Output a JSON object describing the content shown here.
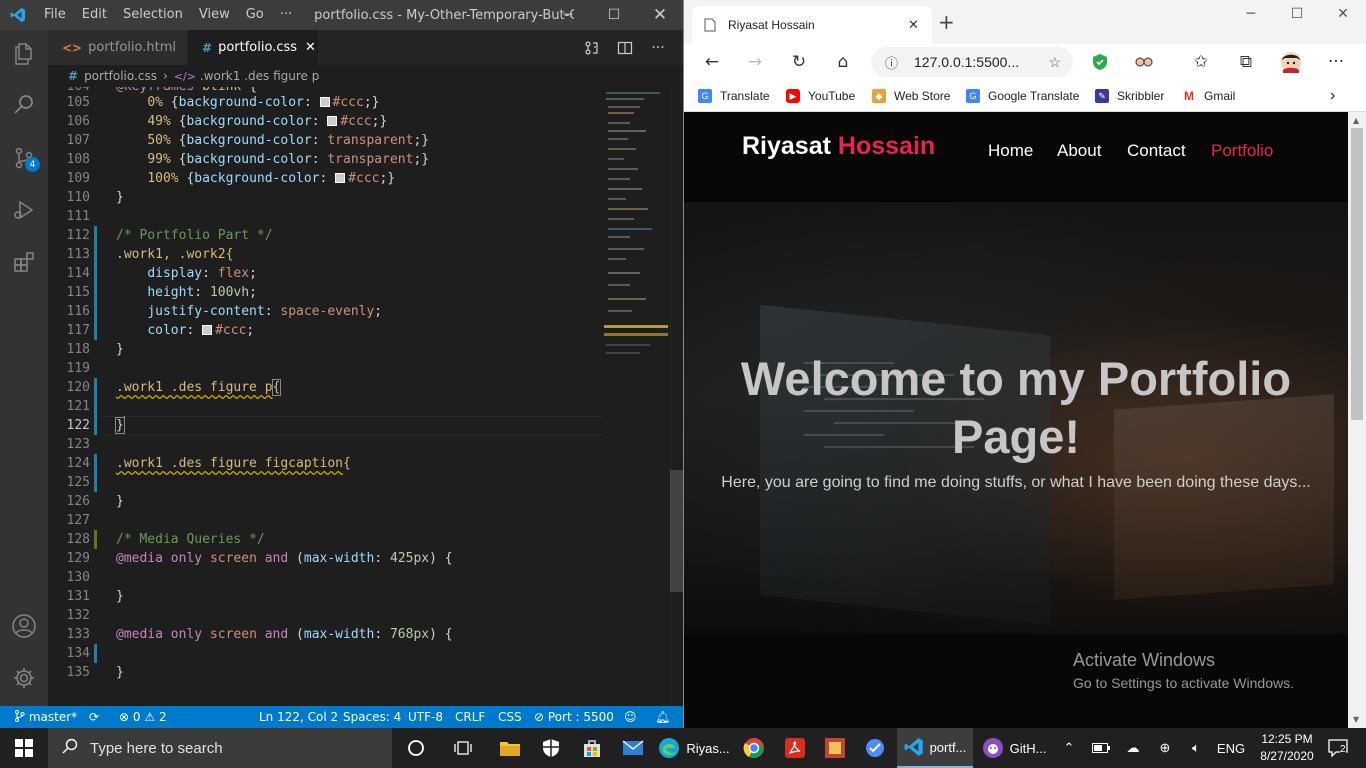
{
  "vscode": {
    "menu": [
      "File",
      "Edit",
      "Selection",
      "View",
      "Go",
      "···"
    ],
    "title": "portfolio.css - My-Other-Temporary-But-Cool-...",
    "tabs": [
      {
        "label": "portfolio.html",
        "icon": "<>",
        "active": false
      },
      {
        "label": "portfolio.css",
        "icon": "#",
        "active": true
      }
    ],
    "breadcrumb": {
      "file": "portfolio.css",
      "symbol": ".work1 .des figure p"
    },
    "scm_badge": "4",
    "status": {
      "branch": "master*",
      "problems_errors": "0",
      "problems_warnings": "2",
      "position": "Ln 122, Col 2",
      "spaces": "Spaces: 4",
      "encoding": "UTF-8",
      "eol": "CRLF",
      "language": "CSS",
      "port": "Port : 5500"
    },
    "lines": [
      {
        "n": "104",
        "t": "@keyframes blink {"
      },
      {
        "n": "105",
        "t": "    0% {background-color: #ccc;}"
      },
      {
        "n": "106",
        "t": "    49% {background-color: #ccc;}"
      },
      {
        "n": "107",
        "t": "    50% {background-color: transparent;}"
      },
      {
        "n": "108",
        "t": "    99% {background-color: transparent;}"
      },
      {
        "n": "109",
        "t": "    100% {background-color: #ccc;}"
      },
      {
        "n": "110",
        "t": "}"
      },
      {
        "n": "111",
        "t": ""
      },
      {
        "n": "112",
        "t": "/* Portfolio Part */"
      },
      {
        "n": "113",
        "t": ".work1, .work2{"
      },
      {
        "n": "114",
        "t": "    display: flex;"
      },
      {
        "n": "115",
        "t": "    height: 100vh;"
      },
      {
        "n": "116",
        "t": "    justify-content: space-evenly;"
      },
      {
        "n": "117",
        "t": "    color: #ccc;"
      },
      {
        "n": "118",
        "t": "}"
      },
      {
        "n": "119",
        "t": ""
      },
      {
        "n": "120",
        "t": ".work1 .des figure p{"
      },
      {
        "n": "121",
        "t": ""
      },
      {
        "n": "122",
        "t": "}"
      },
      {
        "n": "123",
        "t": ""
      },
      {
        "n": "124",
        "t": ".work1 .des figure figcaption{"
      },
      {
        "n": "125",
        "t": ""
      },
      {
        "n": "126",
        "t": "}"
      },
      {
        "n": "127",
        "t": ""
      },
      {
        "n": "128",
        "t": "/* Media Queries */"
      },
      {
        "n": "129",
        "t": "@media only screen and (max-width: 425px) {"
      },
      {
        "n": "130",
        "t": ""
      },
      {
        "n": "131",
        "t": "}"
      },
      {
        "n": "132",
        "t": ""
      },
      {
        "n": "133",
        "t": "@media only screen and (max-width: 768px) {"
      },
      {
        "n": "134",
        "t": ""
      },
      {
        "n": "135",
        "t": "}"
      }
    ]
  },
  "browser": {
    "tab_title": "Riyasat Hossain",
    "url": "127.0.0.1:5500...",
    "bookmarks": [
      "Translate",
      "YouTube",
      "Web Store",
      "Google Translate",
      "Skribbler",
      "Gmail"
    ],
    "site": {
      "logo_first": "Riyasat",
      "logo_last": "Hossain",
      "nav": [
        "Home",
        "About",
        "Contact",
        "Portfolio"
      ],
      "active_nav": "Portfolio",
      "hero_title": "Welcome to my Portfolio Page!",
      "hero_subtitle": "Here, you are going to find me doing stuffs, or what I have been doing these days..."
    },
    "watermark": {
      "line1": "Activate Windows",
      "line2": "Go to Settings to activate Windows."
    }
  },
  "taskbar": {
    "search_placeholder": "Type here to search",
    "apps": [
      {
        "label": "Riyas...",
        "icon": "edge-icon"
      },
      {
        "label": "portf...",
        "icon": "vscode-icon"
      },
      {
        "label": "GitH...",
        "icon": "github-desktop-icon"
      }
    ],
    "language": "ENG",
    "time": "12:25 PM",
    "date": "8/27/2020",
    "notifications": "2"
  },
  "colors": {
    "accent_red": "#e8244c",
    "vscode_blue": "#007acc"
  }
}
